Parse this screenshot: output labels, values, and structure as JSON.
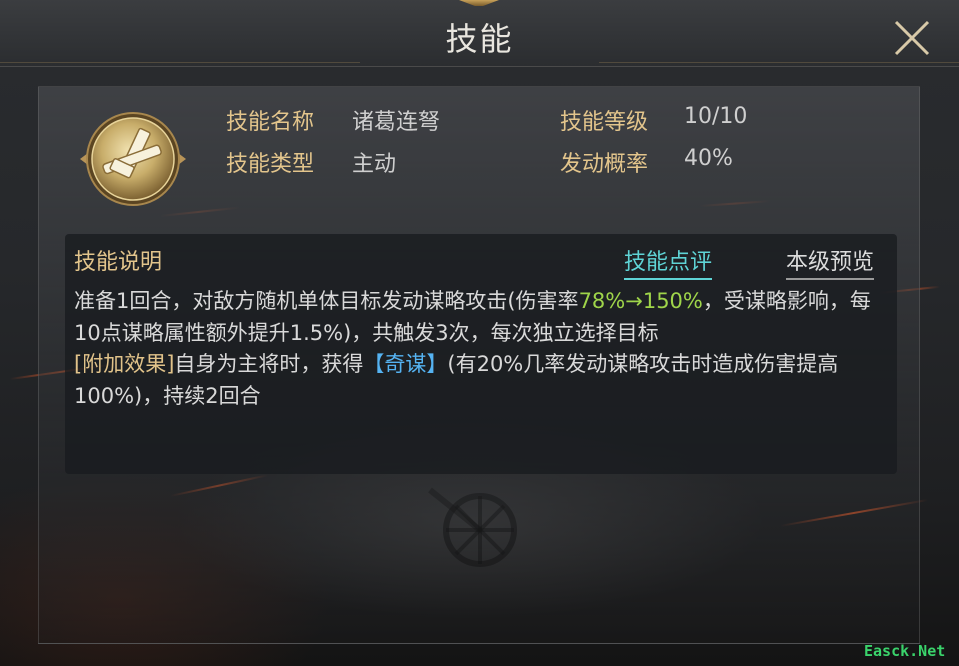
{
  "window": {
    "title": "技能"
  },
  "skill_info": {
    "name_label": "技能名称",
    "name_value": "诸葛连弩",
    "level_label": "技能等级",
    "level_value": "10/10",
    "type_label": "技能类型",
    "type_value": "主动",
    "chance_label": "发动概率",
    "chance_value": "40%"
  },
  "description": {
    "header": "技能说明",
    "tab_review": "技能点评",
    "tab_preview": "本级预览",
    "p1_a": "准备1回合，对敌方随机单体目标发动谋略攻击(伤害率",
    "p1_b": "78%→150%",
    "p1_c": "，受谋略影响，每10点谋略属性额外提升1.5%)，共触发3次，每次独立选择目标",
    "p2_a": "[附加效果]",
    "p2_b": "自身为主将时，获得",
    "p2_c": "【奇谋】",
    "p2_d": "(有20%几率发动谋略攻击时造成伤害提高100%)，持续2回合"
  },
  "watermark": "Easck.Net",
  "colors": {
    "label_gold": "#e3c58c",
    "highlight_green": "#9fd54a",
    "highlight_blue": "#55b3f2",
    "tab_active": "#5fd4d6"
  }
}
